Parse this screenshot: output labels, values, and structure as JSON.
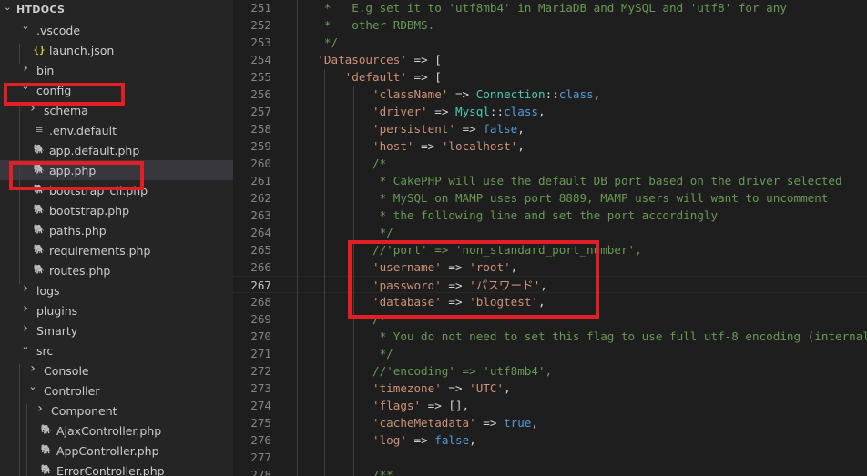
{
  "explorer": {
    "title": "HTDOCS",
    "items": [
      {
        "label": ".vscode",
        "type": "folder",
        "open": true,
        "indent": 1
      },
      {
        "label": "launch.json",
        "type": "json",
        "indent": 2
      },
      {
        "label": "bin",
        "type": "folder",
        "open": false,
        "indent": 1
      },
      {
        "label": "config",
        "type": "folder",
        "open": true,
        "indent": 1
      },
      {
        "label": "schema",
        "type": "folder",
        "open": false,
        "indent": 2
      },
      {
        "label": ".env.default",
        "type": "text",
        "indent": 2
      },
      {
        "label": "app.default.php",
        "type": "php",
        "indent": 2
      },
      {
        "label": "app.php",
        "type": "php",
        "indent": 2,
        "selected": true
      },
      {
        "label": "bootstrap_cli.php",
        "type": "php",
        "indent": 2
      },
      {
        "label": "bootstrap.php",
        "type": "php",
        "indent": 2
      },
      {
        "label": "paths.php",
        "type": "php",
        "indent": 2
      },
      {
        "label": "requirements.php",
        "type": "php",
        "indent": 2
      },
      {
        "label": "routes.php",
        "type": "php",
        "indent": 2
      },
      {
        "label": "logs",
        "type": "folder",
        "open": false,
        "indent": 1
      },
      {
        "label": "plugins",
        "type": "folder",
        "open": false,
        "indent": 1
      },
      {
        "label": "Smarty",
        "type": "folder",
        "open": false,
        "indent": 1
      },
      {
        "label": "src",
        "type": "folder",
        "open": true,
        "indent": 1
      },
      {
        "label": "Console",
        "type": "folder",
        "open": false,
        "indent": 2
      },
      {
        "label": "Controller",
        "type": "folder",
        "open": true,
        "indent": 2
      },
      {
        "label": "Component",
        "type": "folder",
        "open": false,
        "indent": 3
      },
      {
        "label": "AjaxController.php",
        "type": "php",
        "indent": 3
      },
      {
        "label": "AppController.php",
        "type": "php",
        "indent": 3
      },
      {
        "label": "ErrorController.php",
        "type": "php",
        "indent": 3
      }
    ]
  },
  "editor": {
    "active_line": 267,
    "lines": [
      {
        "n": 251,
        "tokens": [
          [
            "cmt",
            "     *   E.g set it to 'utf8mb4' in MariaDB and MySQL and 'utf8' for any"
          ]
        ]
      },
      {
        "n": 252,
        "tokens": [
          [
            "cmt",
            "     *   other RDBMS."
          ]
        ]
      },
      {
        "n": 253,
        "tokens": [
          [
            "cmt",
            "     */"
          ]
        ]
      },
      {
        "n": 254,
        "tokens": [
          [
            "str",
            "    'Datasources'"
          ],
          [
            "op",
            " => ["
          ]
        ]
      },
      {
        "n": 255,
        "tokens": [
          [
            "str",
            "        'default'"
          ],
          [
            "op",
            " => ["
          ]
        ]
      },
      {
        "n": 256,
        "tokens": [
          [
            "str",
            "            'className'"
          ],
          [
            "op",
            " => "
          ],
          [
            "cls",
            "Connection"
          ],
          [
            "op",
            "::"
          ],
          [
            "key",
            "class"
          ],
          [
            "op",
            ","
          ]
        ]
      },
      {
        "n": 257,
        "tokens": [
          [
            "str",
            "            'driver'"
          ],
          [
            "op",
            " => "
          ],
          [
            "cls",
            "Mysql"
          ],
          [
            "op",
            "::"
          ],
          [
            "key",
            "class"
          ],
          [
            "op",
            ","
          ]
        ]
      },
      {
        "n": 258,
        "tokens": [
          [
            "str",
            "            'persistent'"
          ],
          [
            "op",
            " => "
          ],
          [
            "key",
            "false"
          ],
          [
            "op",
            ","
          ]
        ]
      },
      {
        "n": 259,
        "tokens": [
          [
            "str",
            "            'host'"
          ],
          [
            "op",
            " => "
          ],
          [
            "str",
            "'localhost'"
          ],
          [
            "op",
            ","
          ]
        ]
      },
      {
        "n": 260,
        "tokens": [
          [
            "cmt",
            "            /*"
          ]
        ]
      },
      {
        "n": 261,
        "tokens": [
          [
            "cmt",
            "             * CakePHP will use the default DB port based on the driver selected"
          ]
        ]
      },
      {
        "n": 262,
        "tokens": [
          [
            "cmt",
            "             * MySQL on MAMP uses port 8889, MAMP users will want to uncomment"
          ]
        ]
      },
      {
        "n": 263,
        "tokens": [
          [
            "cmt",
            "             * the following line and set the port accordingly"
          ]
        ]
      },
      {
        "n": 264,
        "tokens": [
          [
            "cmt",
            "             */"
          ]
        ]
      },
      {
        "n": 265,
        "tokens": [
          [
            "cmt",
            "            //'port' => 'non_standard_port_number',"
          ]
        ]
      },
      {
        "n": 266,
        "tokens": [
          [
            "str",
            "            'username'"
          ],
          [
            "op",
            " => "
          ],
          [
            "str",
            "'root'"
          ],
          [
            "op",
            ","
          ]
        ]
      },
      {
        "n": 267,
        "tokens": [
          [
            "str",
            "            'password'"
          ],
          [
            "op",
            " => "
          ],
          [
            "str",
            "'パスワード'"
          ],
          [
            "op",
            ","
          ]
        ]
      },
      {
        "n": 268,
        "tokens": [
          [
            "str",
            "            'database'"
          ],
          [
            "op",
            " => "
          ],
          [
            "str",
            "'blogtest'"
          ],
          [
            "op",
            ","
          ]
        ]
      },
      {
        "n": 269,
        "tokens": [
          [
            "cmt",
            "            /*"
          ]
        ]
      },
      {
        "n": 270,
        "tokens": [
          [
            "cmt",
            "             * You do not need to set this flag to use full utf-8 encoding (internal"
          ]
        ]
      },
      {
        "n": 271,
        "tokens": [
          [
            "cmt",
            "             */"
          ]
        ]
      },
      {
        "n": 272,
        "tokens": [
          [
            "cmt",
            "            //'encoding' => 'utf8mb4',"
          ]
        ]
      },
      {
        "n": 273,
        "tokens": [
          [
            "str",
            "            'timezone'"
          ],
          [
            "op",
            " => "
          ],
          [
            "str",
            "'UTC'"
          ],
          [
            "op",
            ","
          ]
        ]
      },
      {
        "n": 274,
        "tokens": [
          [
            "str",
            "            'flags'"
          ],
          [
            "op",
            " => [],"
          ]
        ]
      },
      {
        "n": 275,
        "tokens": [
          [
            "str",
            "            'cacheMetadata'"
          ],
          [
            "op",
            " => "
          ],
          [
            "key",
            "true"
          ],
          [
            "op",
            ","
          ]
        ]
      },
      {
        "n": 276,
        "tokens": [
          [
            "str",
            "            'log'"
          ],
          [
            "op",
            " => "
          ],
          [
            "key",
            "false"
          ],
          [
            "op",
            ","
          ]
        ]
      },
      {
        "n": 277,
        "tokens": [
          [
            "op",
            ""
          ]
        ]
      },
      {
        "n": 278,
        "tokens": [
          [
            "cmt",
            "            /**"
          ]
        ]
      }
    ]
  },
  "colors": {
    "highlight_box": "#e31e24",
    "php_icon": "#a074c4",
    "json_icon": "#cbcb41"
  }
}
